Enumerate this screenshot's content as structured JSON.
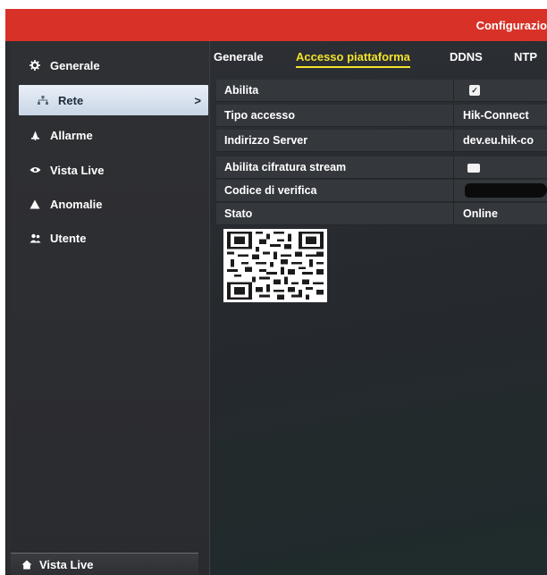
{
  "window": {
    "title": "Configurazio"
  },
  "sidebar": {
    "items": [
      {
        "label": "Generale",
        "icon": "gear-icon"
      },
      {
        "label": "Rete",
        "icon": "network-icon",
        "chevron": ">"
      },
      {
        "label": "Allarme",
        "icon": "alarm-icon"
      },
      {
        "label": "Vista Live",
        "icon": "eye-icon"
      },
      {
        "label": "Anomalie",
        "icon": "warning-icon"
      },
      {
        "label": "Utente",
        "icon": "user-icon"
      }
    ],
    "bottom": {
      "label": "Vista Live",
      "icon": "home-icon"
    }
  },
  "tabs": [
    {
      "label": "Generale",
      "active": false
    },
    {
      "label": "Accesso piattaforma",
      "active": true
    },
    {
      "label": "DDNS",
      "active": false
    },
    {
      "label": "NTP",
      "active": false
    }
  ],
  "form": {
    "abilita": {
      "label": "Abilita",
      "checked": true
    },
    "tipo_accesso": {
      "label": "Tipo accesso",
      "value": "Hik-Connect"
    },
    "indirizzo_server": {
      "label": "Indirizzo Server",
      "value": "dev.eu.hik-co"
    },
    "cifratura": {
      "label": "Abilita cifratura stream",
      "checked": false
    },
    "codice": {
      "label": "Codice di verifica",
      "value_redacted": true
    },
    "stato": {
      "label": "Stato",
      "value": "Online"
    }
  },
  "colors": {
    "titlebar": "#d83228",
    "active_tab": "#f3e32b",
    "background": "#2b2d31"
  }
}
